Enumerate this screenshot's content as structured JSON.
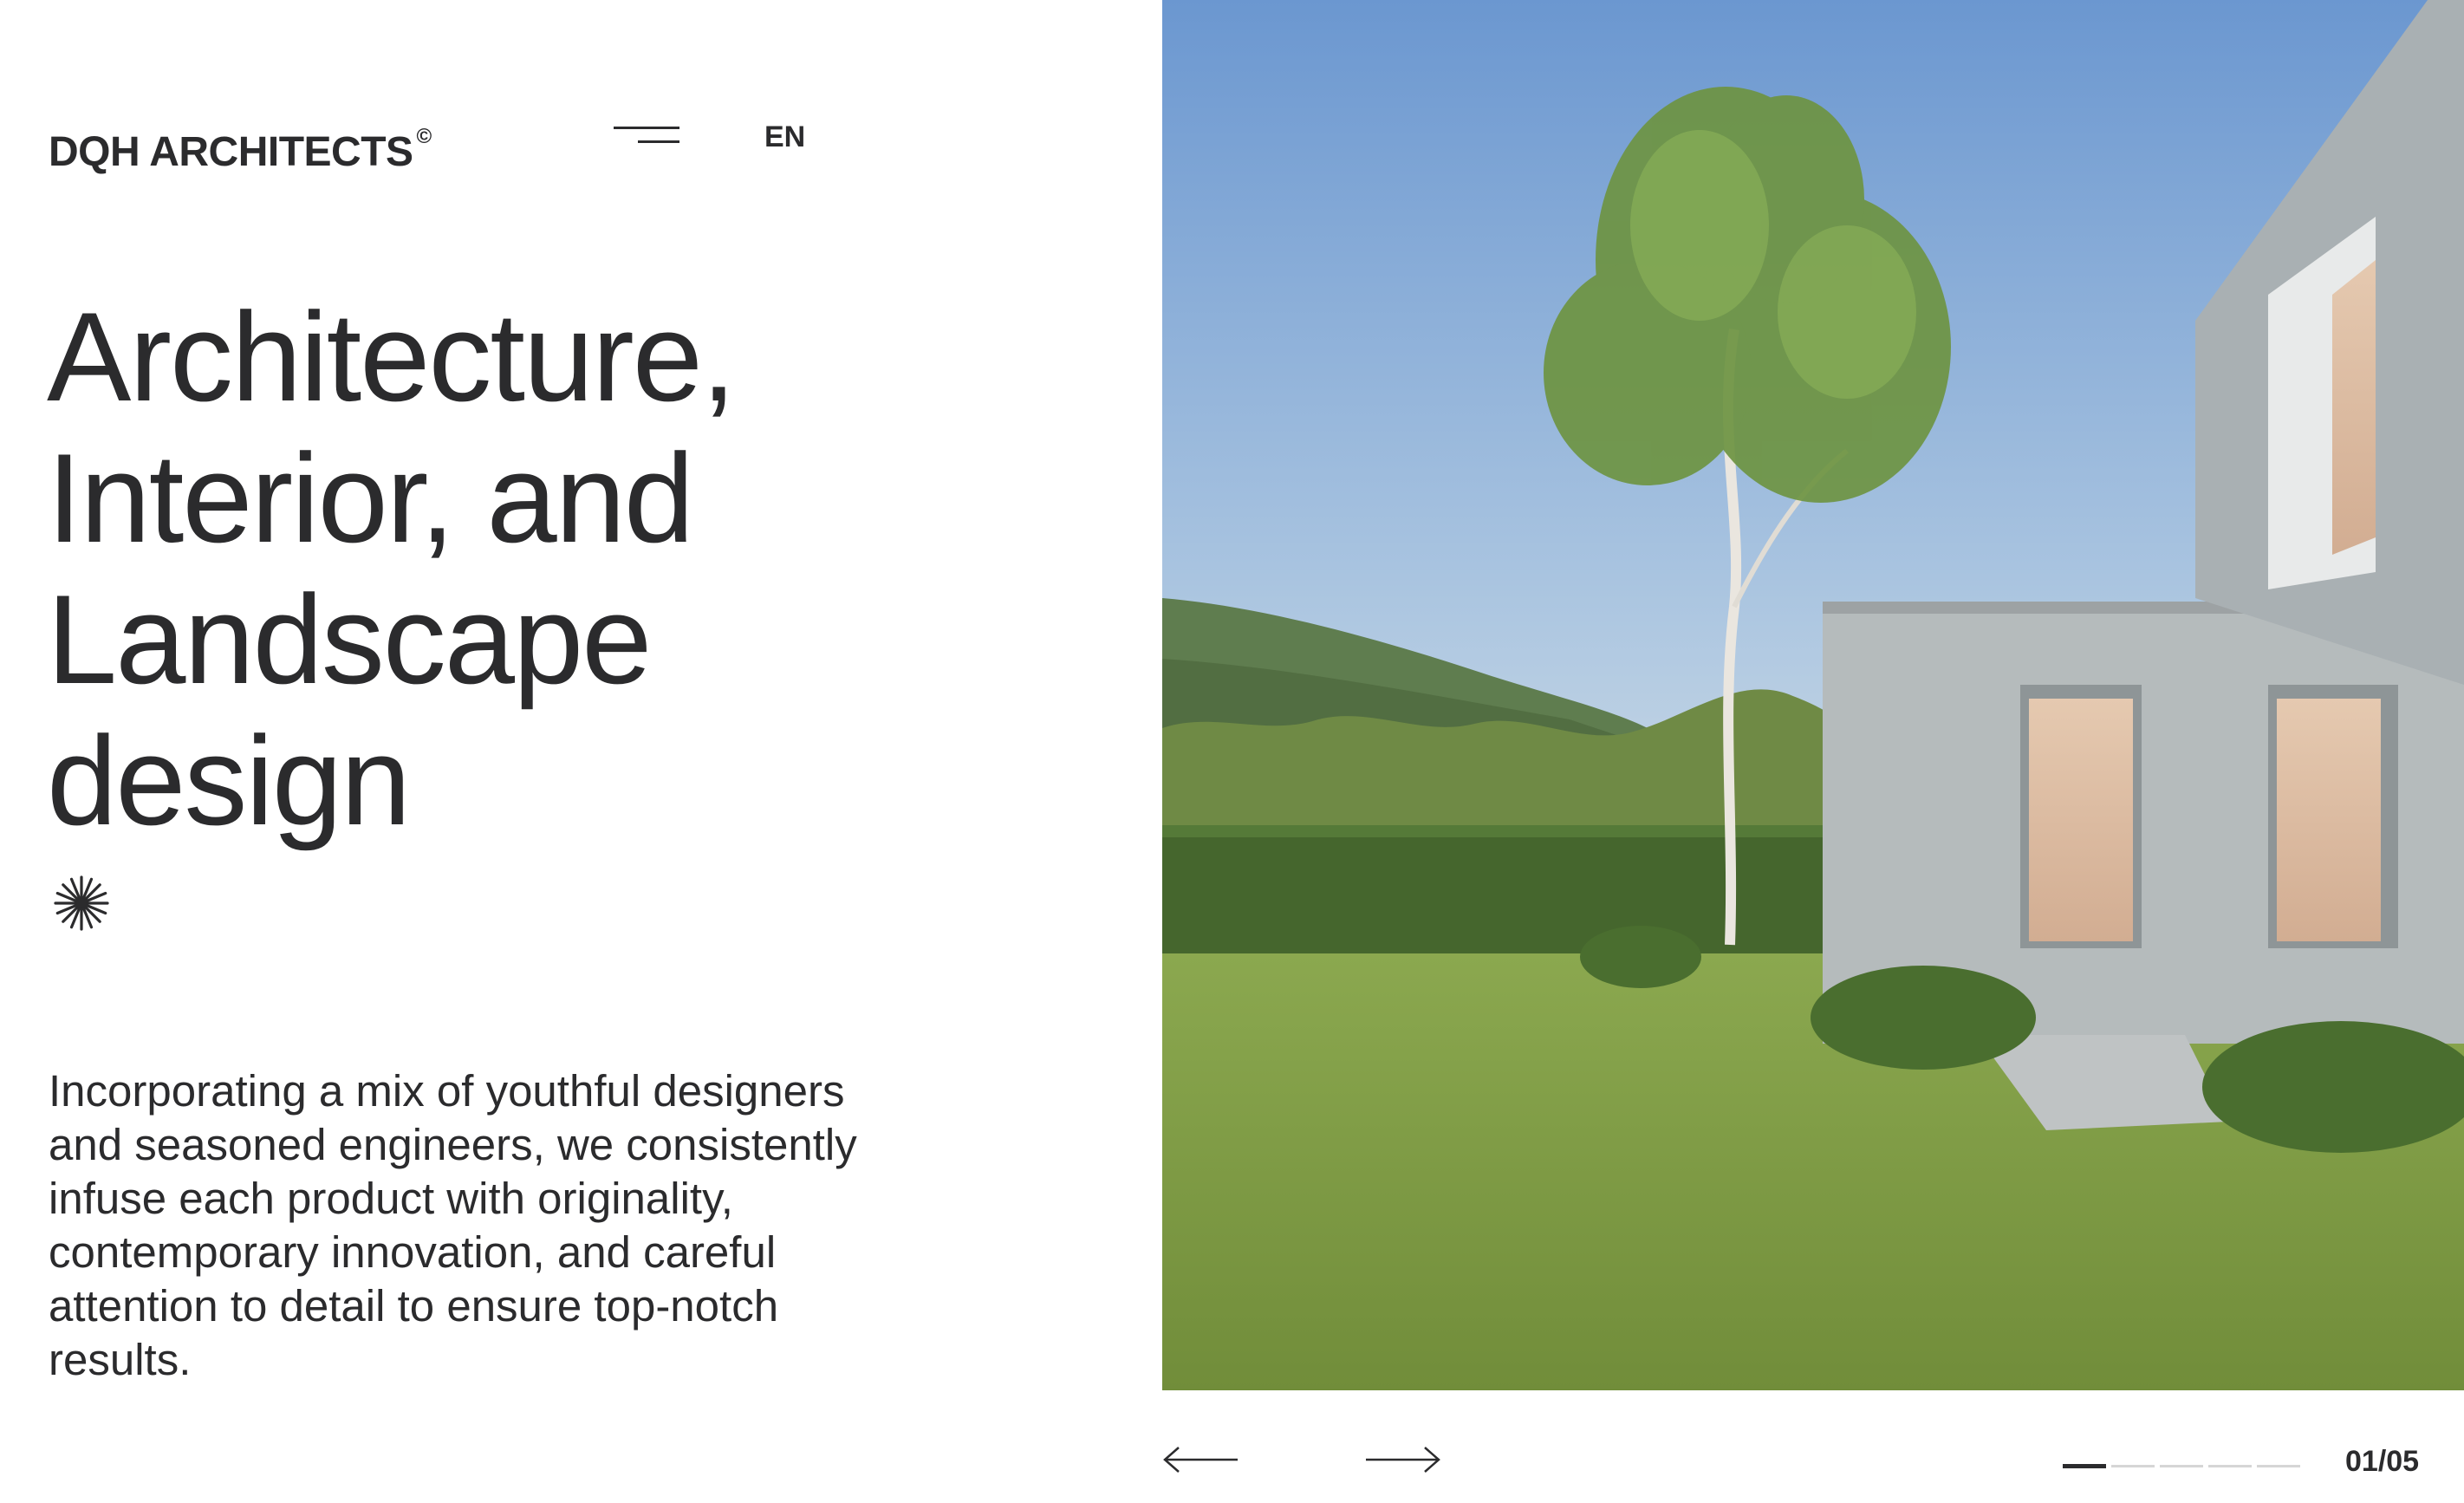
{
  "header": {
    "brand": "DQH ARCHITECTS",
    "brand_mark": "©",
    "menu_icon": "hamburger-menu-icon",
    "language": "EN"
  },
  "hero": {
    "headline_lines": [
      "Architecture,",
      "Interior, and",
      "Landscape",
      "design"
    ],
    "decorative_icon": "asterisk-icon",
    "description": "Incorporating a mix of youthful designers and seasoned engineers, we consistently infuse each product with originality, contemporary innovation, and careful attention to detail to ensure top-notch results."
  },
  "slider": {
    "prev_icon": "arrow-left-icon",
    "next_icon": "arrow-right-icon",
    "current": 1,
    "total": 5,
    "counter": "01/05"
  },
  "colors": {
    "text": "#2b2b2d",
    "background": "#ffffff",
    "progress_inactive": "#d6d6d6",
    "sky": "#6e9ad0",
    "grass": "#7d9a43",
    "building": "#b9bec0"
  }
}
